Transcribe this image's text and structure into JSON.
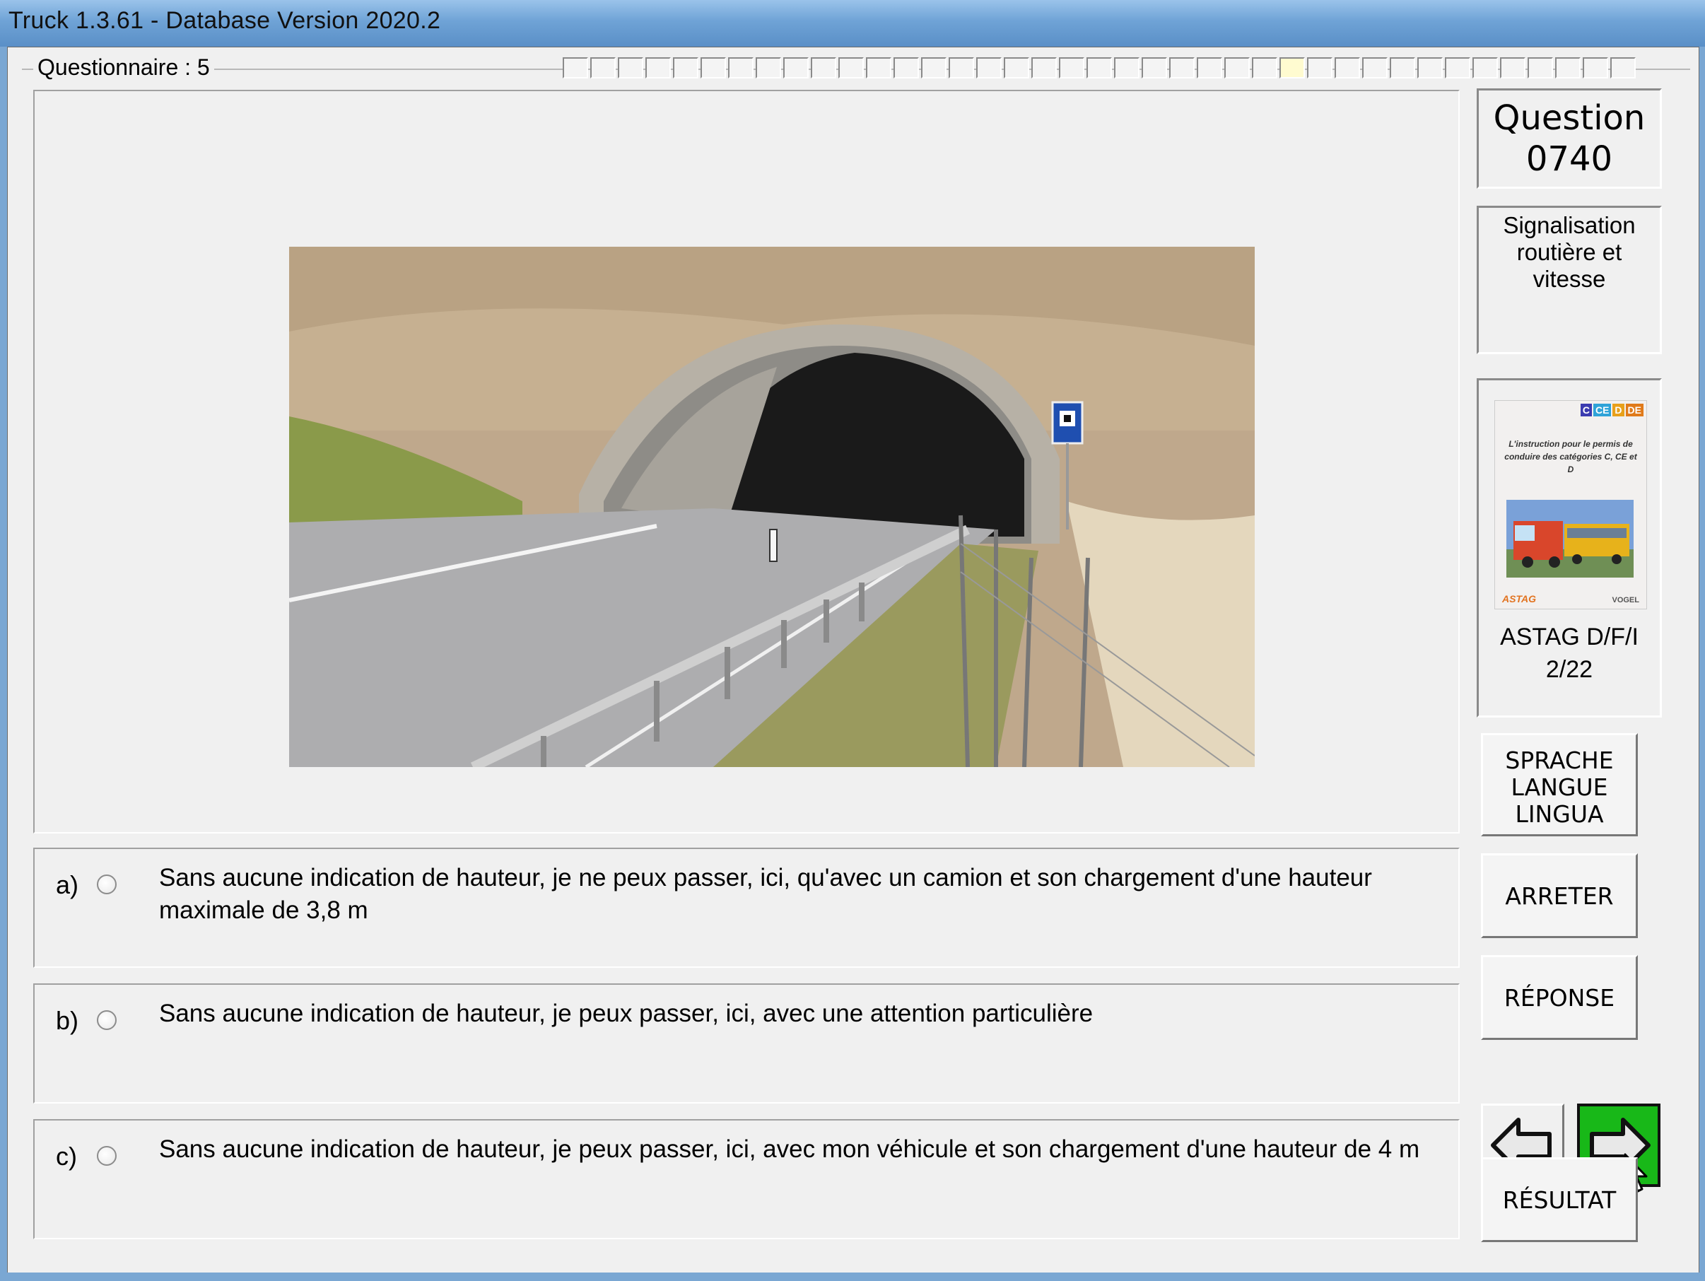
{
  "window": {
    "title": "Truck 1.3.61 - Database Version 2020.2"
  },
  "questionnaire": {
    "label": "Questionnaire : 5",
    "progress": {
      "total_cells": 39,
      "current_index": 26
    }
  },
  "question": {
    "heading": "Question",
    "number": "0740"
  },
  "category": {
    "line1": "Signalisation",
    "line2": "routière et vitesse"
  },
  "book": {
    "cover_title": "L'instruction pour le permis de conduire des catégories C, CE et D",
    "cover_tags": [
      "C",
      "CE",
      "D",
      "DE"
    ],
    "publisher_left": "ASTAG",
    "publisher_right": "VOGEL",
    "label_line1": "ASTAG D/F/I",
    "label_line2": "2/22"
  },
  "answers": [
    {
      "letter": "a)",
      "text": "Sans aucune indication de hauteur, je ne peux passer, ici, qu'avec un camion et son chargement d'une hauteur maximale de 3,8 m"
    },
    {
      "letter": "b)",
      "text": "Sans aucune indication de hauteur, je peux passer, ici, avec une attention particulière"
    },
    {
      "letter": "c)",
      "text": "Sans aucune indication de hauteur, je peux passer, ici, avec mon véhicule et son chargement d'une hauteur de 4 m"
    }
  ],
  "buttons": {
    "language": [
      "SPRACHE",
      "LANGUE",
      "LINGUA"
    ],
    "stop": "ARRETER",
    "answer": "RÉPONSE",
    "result": "RÉSULTAT"
  },
  "icons": {
    "back": "arrow-left-icon",
    "next": "arrow-right-icon"
  },
  "colors": {
    "next_button_bg": "#18b818",
    "titlebar": "#6fa3d6"
  }
}
